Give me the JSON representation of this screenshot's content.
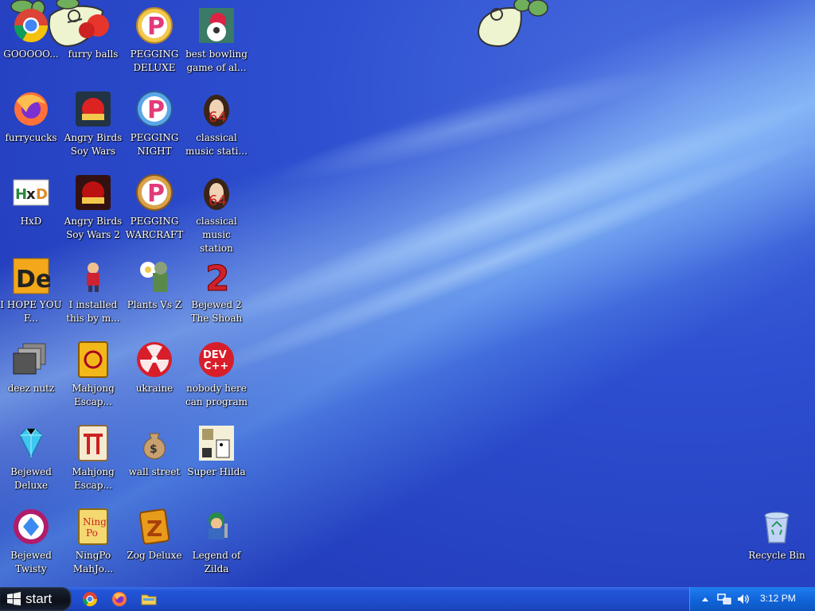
{
  "desktop": {
    "icons": [
      {
        "label": "GOOOOO...",
        "icon": "chrome-icon"
      },
      {
        "label": "furry balls",
        "icon": "furry-balls-icon"
      },
      {
        "label": "PEGGING DELUXE",
        "icon": "pegging-deluxe-icon"
      },
      {
        "label": "best bowling game of al...",
        "icon": "bowling-icon"
      },
      {
        "label": "furrycucks",
        "icon": "firefox-icon"
      },
      {
        "label": "Angry Birds Soy Wars",
        "icon": "angry-birds-icon"
      },
      {
        "label": "PEGGING NIGHT",
        "icon": "pegging-night-icon"
      },
      {
        "label": "classical music stati...",
        "icon": "classical-music-icon"
      },
      {
        "label": "HxD",
        "icon": "hxd-icon"
      },
      {
        "label": "Angry Birds Soy Wars 2",
        "icon": "angry-birds-2-icon"
      },
      {
        "label": "PEGGING WARCRAFT",
        "icon": "pegging-warcraft-icon"
      },
      {
        "label": "classical music station",
        "icon": "classical-music-icon"
      },
      {
        "label": "I HOPE YOU F...",
        "icon": "de-icon"
      },
      {
        "label": "I installed this by m...",
        "icon": "character-icon"
      },
      {
        "label": "Plants Vs Z",
        "icon": "plants-vs-zombies-icon"
      },
      {
        "label": "Bejewed 2 The Shoah",
        "icon": "bejeweled-2-icon"
      },
      {
        "label": "deez nutz",
        "icon": "windows-stack-icon"
      },
      {
        "label": "Mahjong Escap...",
        "icon": "mahjong-icon"
      },
      {
        "label": "ukraine",
        "icon": "radiation-icon"
      },
      {
        "label": "nobody here can program",
        "icon": "devcpp-icon"
      },
      {
        "label": "Bejewed Deluxe",
        "icon": "diamond-icon"
      },
      {
        "label": "Mahjong Escap...",
        "icon": "mahjong-torii-icon"
      },
      {
        "label": "wall street",
        "icon": "money-bag-icon"
      },
      {
        "label": "Super Hilda",
        "icon": "super-hilda-icon"
      },
      {
        "label": "Bejewed Twisty",
        "icon": "bejeweled-twist-icon"
      },
      {
        "label": "NingPo MahJo...",
        "icon": "ningpo-icon"
      },
      {
        "label": "Zog Deluxe",
        "icon": "zog-icon"
      },
      {
        "label": "Legend of Zilda",
        "icon": "legend-icon"
      }
    ],
    "recycle_bin": {
      "label": "Recycle Bin",
      "icon": "recycle-bin-icon"
    }
  },
  "taskbar": {
    "start_label": "start",
    "quick_launch": [
      "chrome-icon",
      "firefox-icon",
      "folder-icon"
    ],
    "tray_icons": [
      "chevron-up-icon",
      "network-icon",
      "volume-icon"
    ],
    "clock": "3:12 PM"
  }
}
